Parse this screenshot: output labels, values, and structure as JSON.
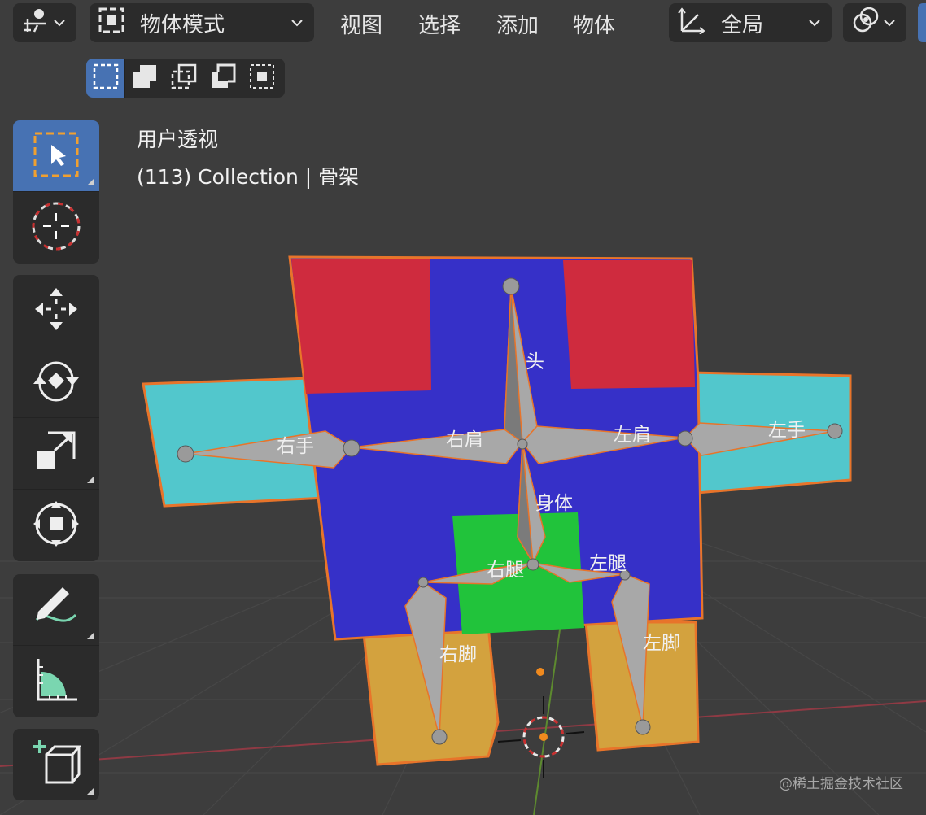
{
  "header": {
    "mode_label": "物体模式",
    "menus": [
      "视图",
      "选择",
      "添加",
      "物体"
    ],
    "transform_orientation": "全局"
  },
  "toolbar": {
    "icons": [
      "select-box-icon",
      "cursor-icon",
      "move-icon",
      "rotate-icon",
      "scale-icon",
      "transform-icon",
      "annotate-icon",
      "measure-icon",
      "add-cube-icon"
    ],
    "active": "select-box-icon"
  },
  "viewport": {
    "view_name": "用户透视",
    "object_info": "(113) Collection | 骨架"
  },
  "bones": {
    "head": "头",
    "body": "身体",
    "shoulder_r": "右肩",
    "shoulder_l": "左肩",
    "hand_r": "右手",
    "hand_l": "左手",
    "leg_r": "右腿",
    "leg_l": "左腿",
    "foot_r": "右脚",
    "foot_l": "左脚"
  },
  "colors": {
    "accent": "#4772b3",
    "torso": "#3630c8",
    "head_blocks": "#cf2b3e",
    "arms": "#52c7cc",
    "hips": "#21c33b",
    "legs": "#d3a23e",
    "outline": "#e8742a"
  },
  "watermark": "@稀土掘金技术社区"
}
